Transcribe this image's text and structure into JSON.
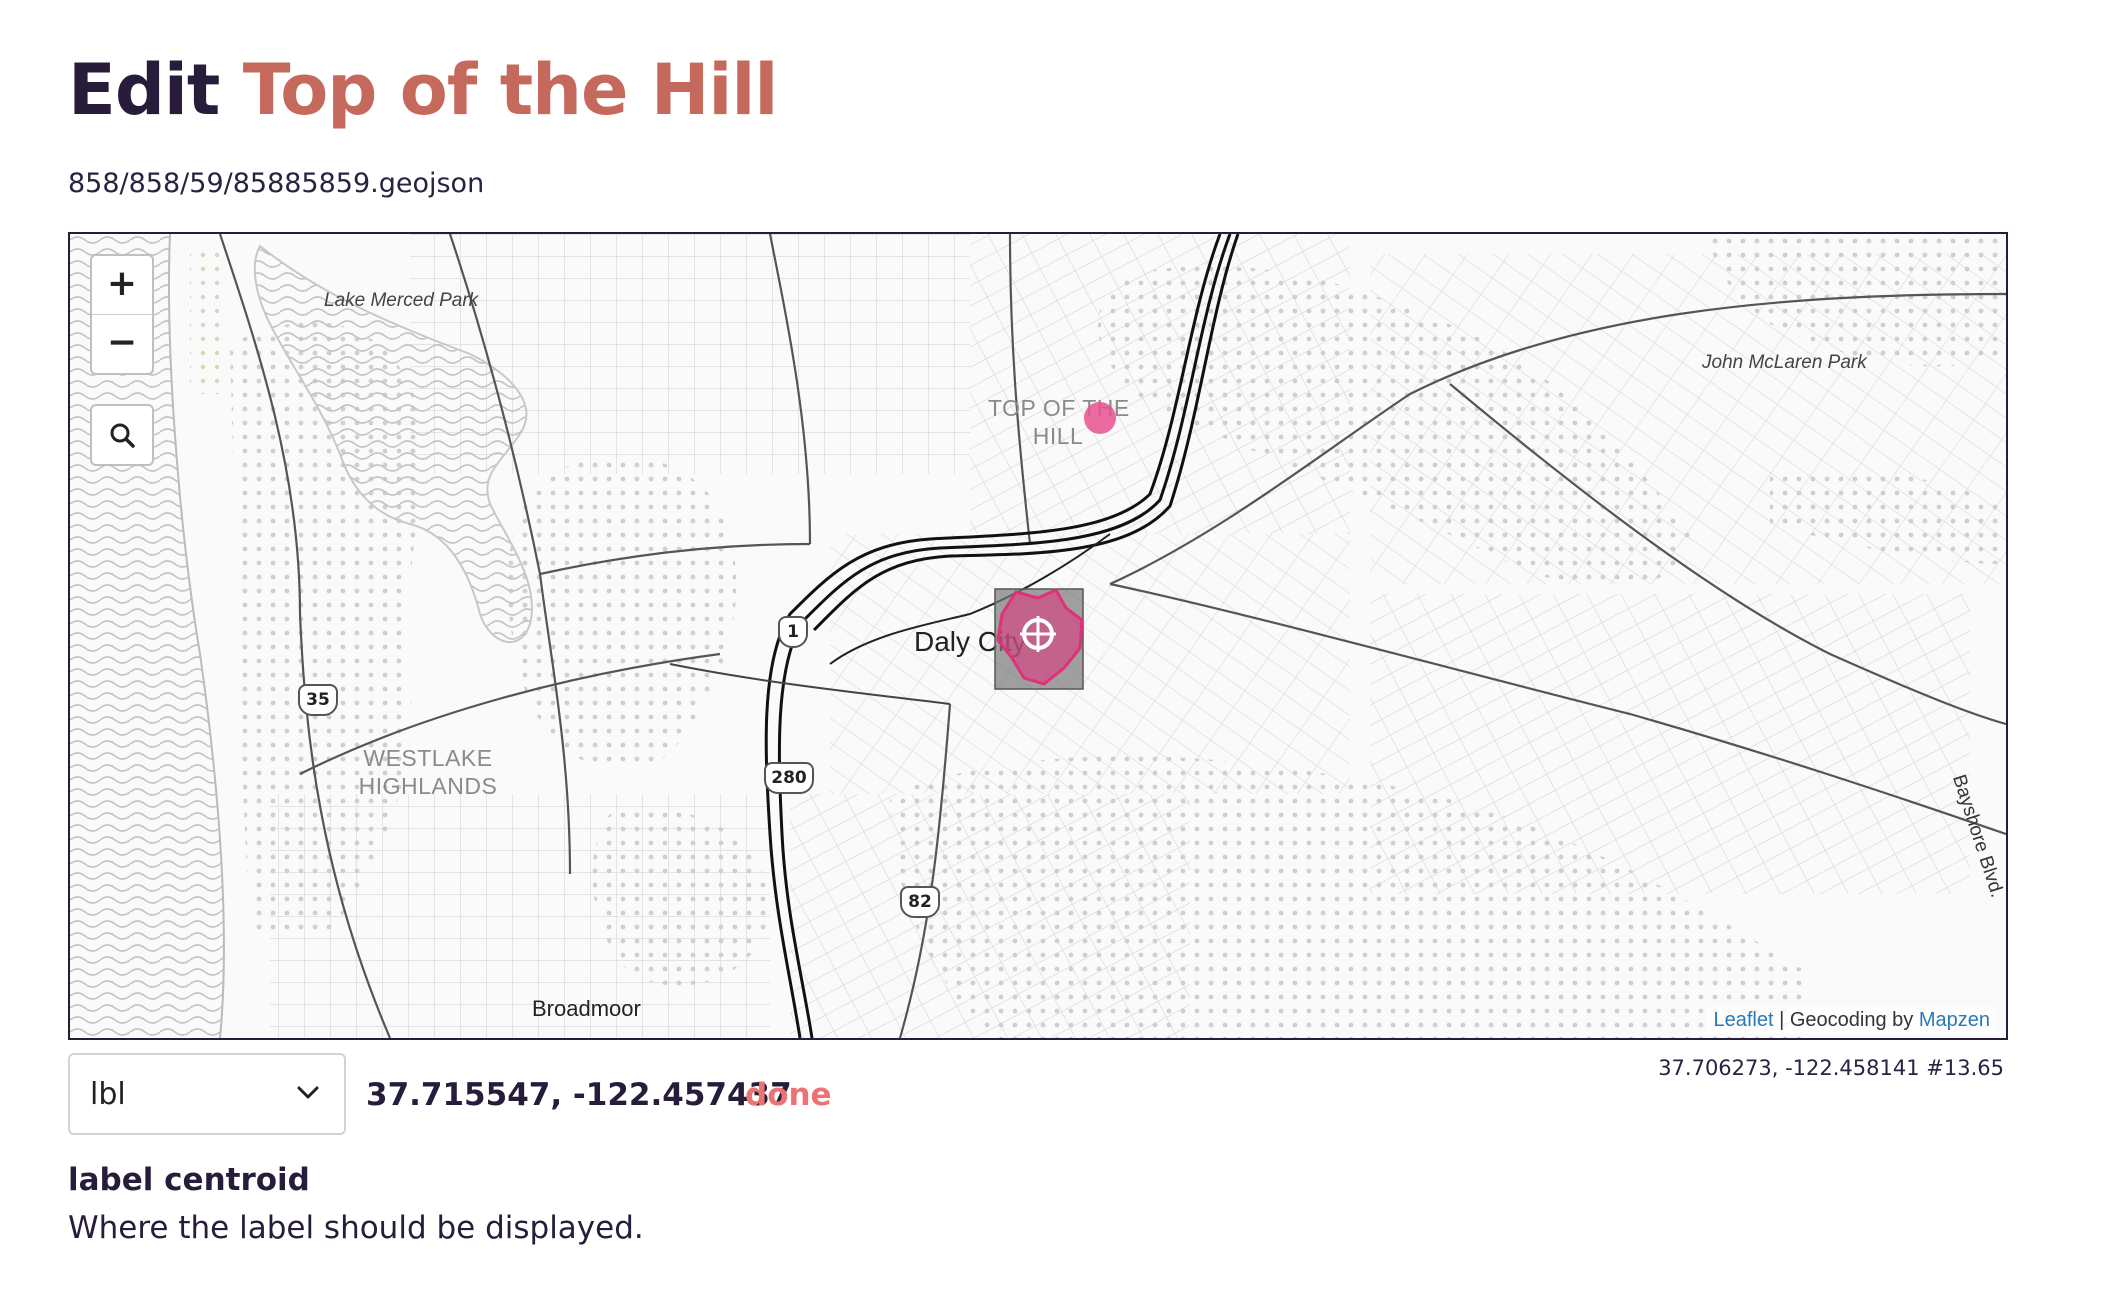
{
  "header": {
    "title_prefix": "Edit",
    "title_name": "Top of the Hill",
    "file_path": "858/858/59/85885859.geojson"
  },
  "map": {
    "zoom_in_label": "+",
    "zoom_out_label": "−",
    "search_icon": "search-icon",
    "labels": {
      "lake_merced": "Lake Merced Park",
      "mclaren": "John McLaren Park",
      "top_of_hill_line1": "TOP OF THE",
      "top_of_hill_line2": "HILL",
      "daly_city": "Daly City",
      "westlake_line1": "WESTLAKE",
      "westlake_line2": "HIGHLANDS",
      "broadmoor": "Broadmoor",
      "bayshore": "Bayshore Blvd."
    },
    "shields": {
      "r1": "1",
      "r35": "35",
      "r280": "280",
      "r82": "82"
    },
    "attribution": {
      "leaflet": "Leaflet",
      "separator": " | Geocoding by ",
      "mapzen": "Mapzen"
    },
    "colors": {
      "polygon": "#e0307a",
      "marker": "#e8508f",
      "border": "#261d3a"
    }
  },
  "map_status": {
    "coords": "37.706273, -122.458141 #13.65"
  },
  "property": {
    "selected": "lbl",
    "value": "37.715547, -122.457437",
    "done_label": "done",
    "title": "label centroid",
    "description": "Where the label should be displayed."
  },
  "theme": {
    "title_dark": "#271d3b",
    "title_accent": "#c6695d",
    "done_color": "#ec7373",
    "link_color": "#2b78b7"
  }
}
